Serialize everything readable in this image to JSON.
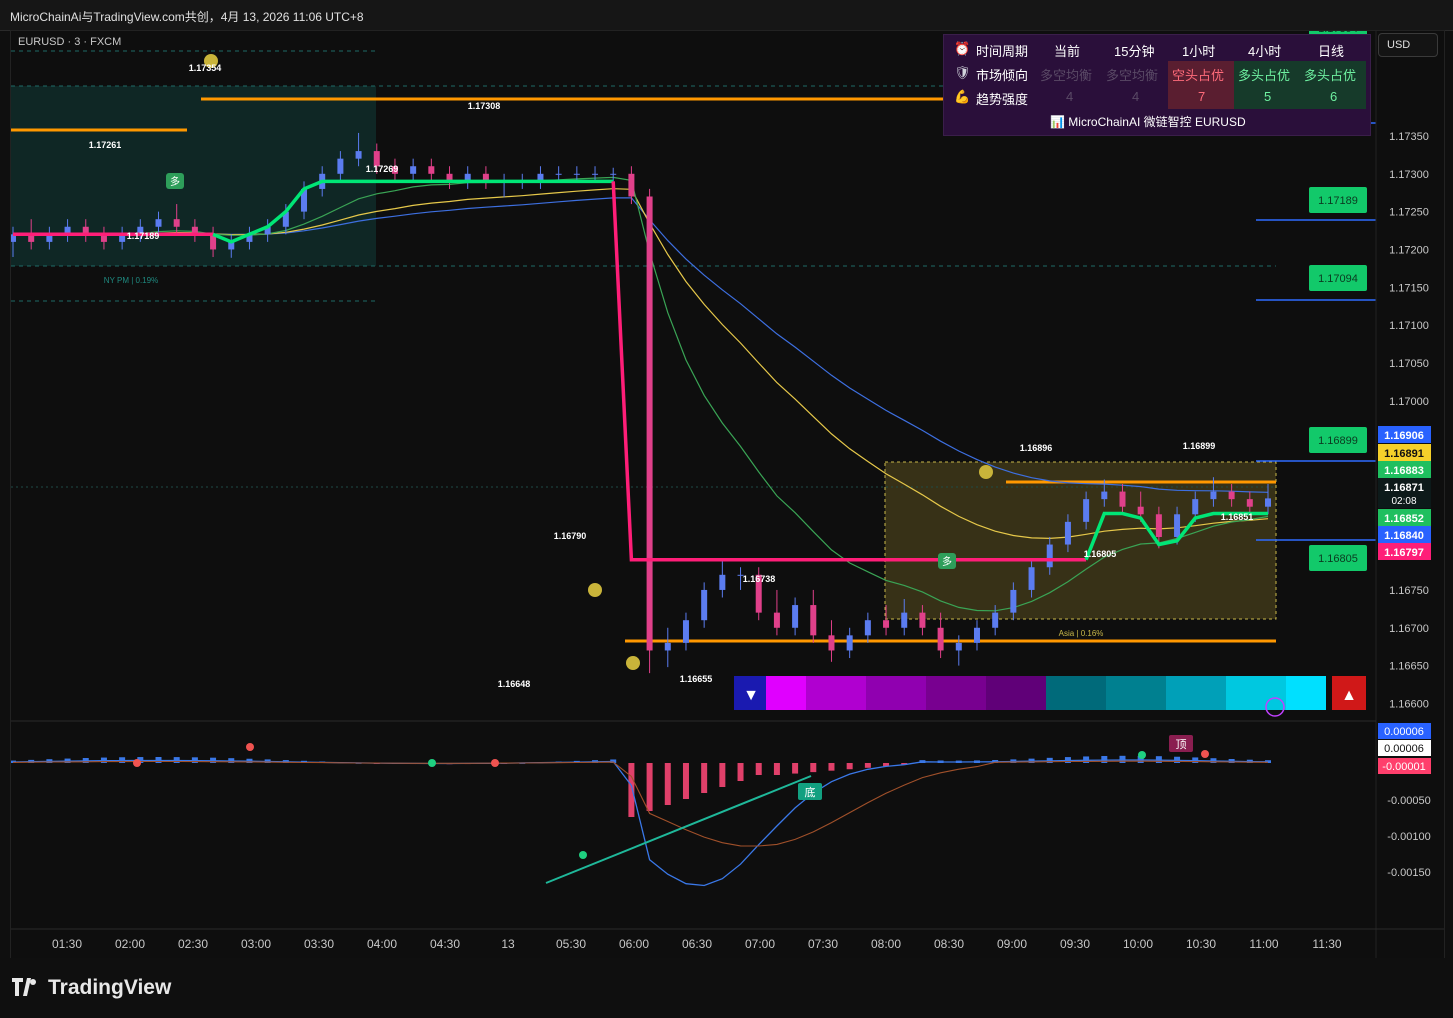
{
  "window_title": "MicroChainAi与TradingView.com共创，4月 13, 2026 11:06 UTC+8",
  "symbol": "EURUSD · 3 · FXCM",
  "currency_button": "USD",
  "brand": "TradingView",
  "dashboard": {
    "row1": {
      "icon": "alarm-clock-icon",
      "label": "时间周期",
      "cols": [
        "当前",
        "15分钟",
        "1小时",
        "4小时",
        "日线"
      ]
    },
    "row2": {
      "icon": "shield-icon",
      "label": "市场倾向",
      "cols": [
        "多空均衡",
        "多空均衡",
        "空头占优",
        "多头占优",
        "多头占优"
      ]
    },
    "row3": {
      "icon": "muscle-icon",
      "label": "趋势强度",
      "cols": [
        "4",
        "4",
        "7",
        "5",
        "6"
      ]
    },
    "footer": "📊 MicroChainAI 微链智控 EURUSD"
  },
  "colors": {
    "up": "#26a69a",
    "down": "#ef5350",
    "trend_up": "#00e676",
    "trend_down": "#ff1e78",
    "level": "#ff9800",
    "ema_yellow": "#e6c84a",
    "ema_blue": "#3d6fe0",
    "ema_green": "#3aa455"
  },
  "chart_data": {
    "type": "candlestick",
    "time_labels": [
      "01:30",
      "02:00",
      "02:30",
      "03:00",
      "03:30",
      "04:00",
      "04:30",
      "13",
      "05:30",
      "06:00",
      "06:30",
      "07:00",
      "07:30",
      "08:00",
      "08:30",
      "09:00",
      "09:30",
      "10:00",
      "10:30",
      "11:00",
      "11:30"
    ],
    "price_axis": [
      "1.17350",
      "1.17300",
      "1.17250",
      "1.17200",
      "1.17150",
      "1.17100",
      "1.17050",
      "1.17000",
      "1.16950",
      "1.16900",
      "1.16850",
      "1.16800",
      "1.16750",
      "1.16700",
      "1.16650",
      "1.16600"
    ],
    "ylim": [
      1.1659,
      1.1742
    ],
    "price_tags": [
      {
        "value": "1.16906",
        "color": "#2962ff"
      },
      {
        "value": "1.16891",
        "color": "#f5d02a"
      },
      {
        "value": "1.16883",
        "color": "#1fbf5f"
      },
      {
        "value": "1.16871",
        "sub": "02:08",
        "color": "#0d1a1a"
      },
      {
        "value": "1.16852",
        "color": "#1fbf5f"
      },
      {
        "value": "1.16840",
        "color": "#2962ff"
      },
      {
        "value": "1.16797",
        "color": "#ff1e78"
      }
    ],
    "target_tags": [
      "1.17394",
      "1.17308",
      "1.17189",
      "1.17094",
      "1.16899",
      "1.16805"
    ],
    "swing_labels": [
      "1.17354",
      "1.17261",
      "1.17308",
      "1.17269",
      "1.17189",
      "1.16790",
      "1.16738",
      "1.16648",
      "1.16655",
      "1.16896",
      "1.16899",
      "1.16851",
      "1.16805"
    ],
    "session_labels": [
      "NY PM | 0.19%",
      "Asia | 0.16%"
    ],
    "signal_labels": [
      "多",
      "多"
    ],
    "candles": [
      [
        0,
        1.1721,
        1.1723,
        1.1719,
        1.1722
      ],
      [
        1,
        1.1722,
        1.1724,
        1.172,
        1.1721
      ],
      [
        2,
        1.1721,
        1.1723,
        1.172,
        1.1722
      ],
      [
        3,
        1.1722,
        1.1724,
        1.1721,
        1.1723
      ],
      [
        4,
        1.1723,
        1.1724,
        1.1721,
        1.1722
      ],
      [
        5,
        1.1722,
        1.1723,
        1.172,
        1.1721
      ],
      [
        6,
        1.1721,
        1.1723,
        1.172,
        1.1722
      ],
      [
        7,
        1.1722,
        1.1724,
        1.1721,
        1.1723
      ],
      [
        8,
        1.1723,
        1.1725,
        1.1722,
        1.1724
      ],
      [
        9,
        1.1724,
        1.1726,
        1.1722,
        1.1723
      ],
      [
        10,
        1.1723,
        1.1724,
        1.1721,
        1.1722
      ],
      [
        11,
        1.1722,
        1.1723,
        1.1719,
        1.172
      ],
      [
        12,
        1.172,
        1.1722,
        1.17189,
        1.1721
      ],
      [
        13,
        1.1721,
        1.1723,
        1.172,
        1.1722
      ],
      [
        14,
        1.1722,
        1.1724,
        1.1721,
        1.1723
      ],
      [
        15,
        1.1723,
        1.1726,
        1.1722,
        1.1725
      ],
      [
        16,
        1.1725,
        1.1729,
        1.1724,
        1.1728
      ],
      [
        17,
        1.1728,
        1.1731,
        1.1727,
        1.173
      ],
      [
        18,
        1.173,
        1.1733,
        1.1729,
        1.1732
      ],
      [
        19,
        1.1732,
        1.17354,
        1.1731,
        1.1733
      ],
      [
        20,
        1.1733,
        1.1734,
        1.173,
        1.1731
      ],
      [
        21,
        1.1731,
        1.1732,
        1.1729,
        1.173
      ],
      [
        22,
        1.173,
        1.1732,
        1.1729,
        1.1731
      ],
      [
        23,
        1.1731,
        1.1732,
        1.1729,
        1.173
      ],
      [
        24,
        1.173,
        1.1731,
        1.1728,
        1.1729
      ],
      [
        25,
        1.1729,
        1.1731,
        1.1728,
        1.173
      ],
      [
        26,
        1.173,
        1.1731,
        1.1728,
        1.1729
      ],
      [
        27,
        1.1729,
        1.173,
        1.17269,
        1.1729
      ],
      [
        28,
        1.1729,
        1.173,
        1.1728,
        1.1729
      ],
      [
        29,
        1.1729,
        1.1731,
        1.1728,
        1.173
      ],
      [
        30,
        1.173,
        1.1731,
        1.1729,
        1.173
      ],
      [
        31,
        1.173,
        1.1731,
        1.1729,
        1.173
      ],
      [
        32,
        1.173,
        1.1731,
        1.1729,
        1.173
      ],
      [
        33,
        1.173,
        1.17308,
        1.1729,
        1.173
      ],
      [
        34,
        1.173,
        1.1731,
        1.1726,
        1.1727
      ],
      [
        35,
        1.1727,
        1.1728,
        1.1664,
        1.1667
      ],
      [
        36,
        1.1667,
        1.167,
        1.16648,
        1.1668
      ],
      [
        37,
        1.1668,
        1.1672,
        1.1667,
        1.1671
      ],
      [
        38,
        1.1671,
        1.1676,
        1.167,
        1.1675
      ],
      [
        39,
        1.1675,
        1.1679,
        1.1674,
        1.1677
      ],
      [
        40,
        1.1677,
        1.1678,
        1.1675,
        1.1677
      ],
      [
        41,
        1.1677,
        1.1678,
        1.1671,
        1.1672
      ],
      [
        42,
        1.1672,
        1.1675,
        1.1669,
        1.167
      ],
      [
        43,
        1.167,
        1.1674,
        1.1669,
        1.1673
      ],
      [
        44,
        1.1673,
        1.1675,
        1.1668,
        1.1669
      ],
      [
        45,
        1.1669,
        1.1671,
        1.16655,
        1.1667
      ],
      [
        46,
        1.1667,
        1.167,
        1.1666,
        1.1669
      ],
      [
        47,
        1.1669,
        1.1672,
        1.1668,
        1.1671
      ],
      [
        48,
        1.1671,
        1.1673,
        1.1669,
        1.167
      ],
      [
        49,
        1.167,
        1.16738,
        1.1669,
        1.1672
      ],
      [
        50,
        1.1672,
        1.1673,
        1.1669,
        1.167
      ],
      [
        51,
        1.167,
        1.1672,
        1.1666,
        1.1667
      ],
      [
        52,
        1.1667,
        1.1669,
        1.1665,
        1.1668
      ],
      [
        53,
        1.1668,
        1.1671,
        1.1667,
        1.167
      ],
      [
        54,
        1.167,
        1.1673,
        1.1669,
        1.1672
      ],
      [
        55,
        1.1672,
        1.1676,
        1.1671,
        1.1675
      ],
      [
        56,
        1.1675,
        1.1679,
        1.1674,
        1.1678
      ],
      [
        57,
        1.1678,
        1.1682,
        1.1677,
        1.1681
      ],
      [
        58,
        1.1681,
        1.1685,
        1.168,
        1.1684
      ],
      [
        59,
        1.1684,
        1.1688,
        1.1683,
        1.1687
      ],
      [
        60,
        1.1687,
        1.16896,
        1.1686,
        1.1688
      ],
      [
        61,
        1.1688,
        1.1689,
        1.1685,
        1.1686
      ],
      [
        62,
        1.1686,
        1.1688,
        1.1684,
        1.1685
      ],
      [
        63,
        1.1685,
        1.1686,
        1.16805,
        1.1682
      ],
      [
        64,
        1.1682,
        1.1686,
        1.1681,
        1.1685
      ],
      [
        65,
        1.1685,
        1.1688,
        1.1684,
        1.1687
      ],
      [
        66,
        1.1687,
        1.16899,
        1.1686,
        1.1688
      ],
      [
        67,
        1.1688,
        1.1689,
        1.1686,
        1.1687
      ],
      [
        68,
        1.1687,
        1.1688,
        1.16851,
        1.1686
      ],
      [
        69,
        1.1686,
        1.1689,
        1.1685,
        1.16871
      ]
    ]
  },
  "oscillator": {
    "axis": [
      "0.00006",
      "0.00006",
      "-0.00001",
      "-0.00050",
      "-0.00100",
      "-0.00150"
    ],
    "labels": [
      "顶",
      "底"
    ]
  }
}
